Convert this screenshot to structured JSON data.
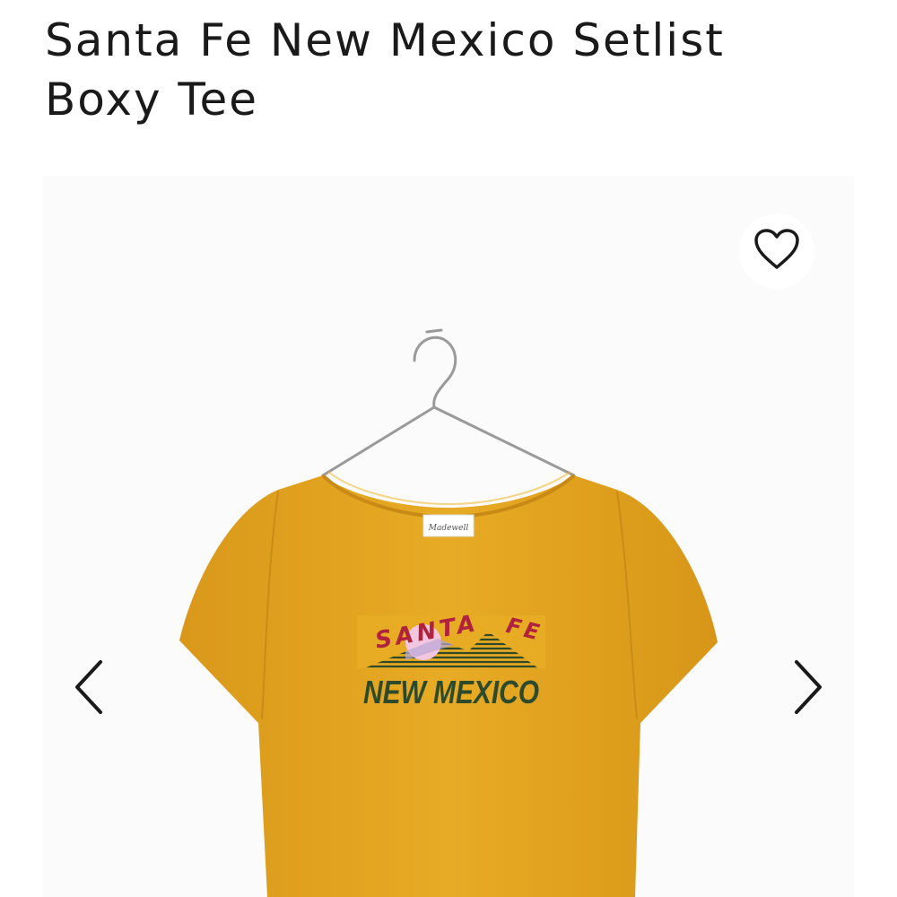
{
  "product": {
    "title": "Santa Fe New Mexico Setlist Boxy Tee"
  },
  "image": {
    "label_brand": "Madewell",
    "graphic_line1_left": "SANTA",
    "graphic_line1_right": "FE",
    "graphic_line2": "NEW MEXICO"
  },
  "icons": {
    "favorite": "heart-outline-icon",
    "previous": "chevron-left-icon",
    "next": "chevron-right-icon"
  },
  "colors": {
    "shirt": "#e7a920",
    "graphic_red": "#b0233e",
    "graphic_green": "#2e4a2c",
    "sun": "#f3c6df",
    "text": "#1a1a1a"
  }
}
